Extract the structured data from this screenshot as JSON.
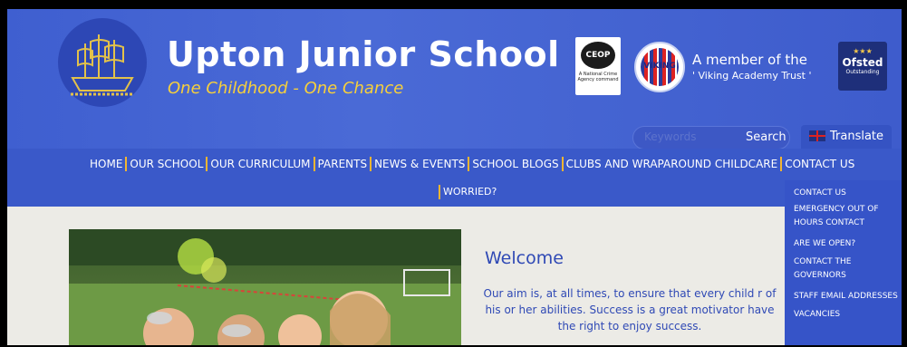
{
  "header": {
    "school_name": "Upton Junior School",
    "motto": "One Childhood - One Chance",
    "ceop_logo": "CEOP",
    "ceop_caption": "A National Crime Agency command",
    "viking_logo": "VIKING",
    "member_line1": "A member of the",
    "member_line2": "' Viking Academy Trust '",
    "ofsted_name": "Ofsted",
    "ofsted_sub": "Outstanding",
    "search_placeholder": "Keywords",
    "search_button": "Search",
    "translate_label": "Translate"
  },
  "nav": {
    "items": [
      "HOME",
      "OUR SCHOOL",
      "OUR CURRICULUM",
      "PARENTS",
      "NEWS & EVENTS",
      "SCHOOL BLOGS",
      "CLUBS AND WRAPAROUND CHILDCARE",
      "CONTACT US"
    ],
    "row2_item": "WORRIED?"
  },
  "dropdown": {
    "items": [
      "CONTACT US",
      "EMERGENCY OUT OF HOURS CONTACT",
      "ARE WE OPEN?",
      "CONTACT THE GOVERNORS",
      "STAFF EMAIL ADDRESSES",
      "VACANCIES"
    ]
  },
  "main": {
    "welcome_heading": "Welcome",
    "body_text": "Our aim is, at all times, to ensure that every child r of his or her abilities. Success is a great motivator have the right to enjoy success."
  },
  "colors": {
    "header_blue": "#4a6ad6",
    "motto_yellow": "#f7d03b",
    "nav_separator": "#f2b531",
    "text_blue": "#2f49b5"
  }
}
